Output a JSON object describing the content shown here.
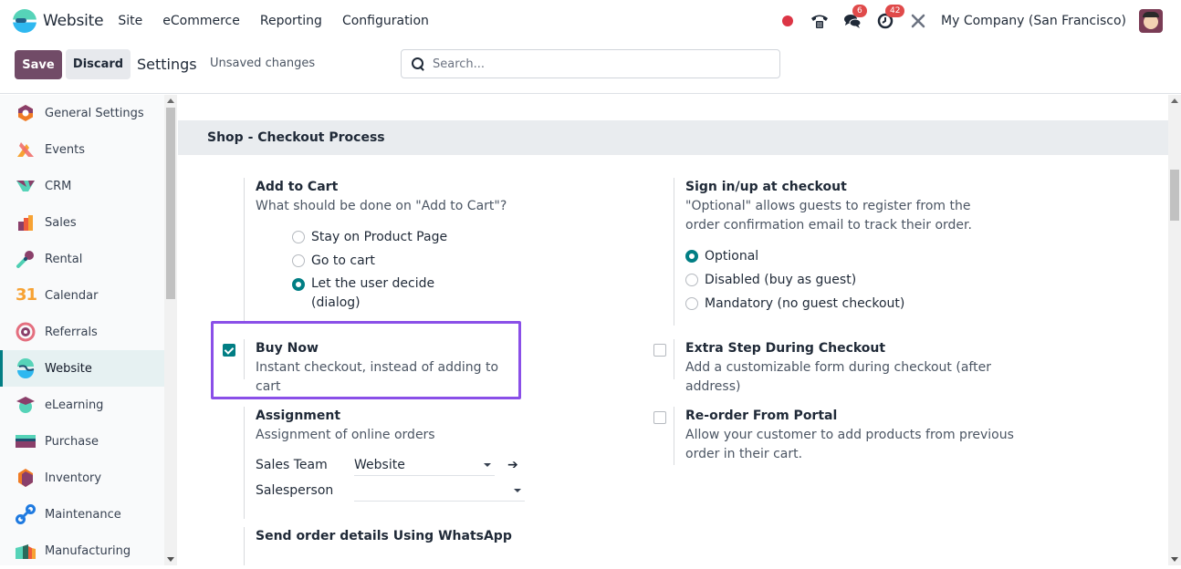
{
  "topbar": {
    "app_name": "Website",
    "menu": [
      "Site",
      "eCommerce",
      "Reporting",
      "Configuration"
    ],
    "messages_badge": "6",
    "activities_badge": "42",
    "company": "My Company (San Francisco)",
    "icons": [
      "recording-dot-icon",
      "phone-icon",
      "chat-icon",
      "clock-icon",
      "tools-icon",
      "user-avatar"
    ]
  },
  "controlbar": {
    "save_label": "Save",
    "discard_label": "Discard",
    "breadcrumb": "Settings",
    "status": "Unsaved changes",
    "search_placeholder": "Search...",
    "search_value": ""
  },
  "sidebar": {
    "items": [
      {
        "label": "General Settings",
        "icon": "general-settings-icon",
        "active": false
      },
      {
        "label": "Events",
        "icon": "events-icon",
        "active": false
      },
      {
        "label": "CRM",
        "icon": "crm-icon",
        "active": false
      },
      {
        "label": "Sales",
        "icon": "sales-icon",
        "active": false
      },
      {
        "label": "Rental",
        "icon": "rental-icon",
        "active": false
      },
      {
        "label": "Calendar",
        "icon": "calendar-icon",
        "active": false
      },
      {
        "label": "Referrals",
        "icon": "referrals-icon",
        "active": false
      },
      {
        "label": "Website",
        "icon": "website-icon",
        "active": true
      },
      {
        "label": "eLearning",
        "icon": "elearning-icon",
        "active": false
      },
      {
        "label": "Purchase",
        "icon": "purchase-icon",
        "active": false
      },
      {
        "label": "Inventory",
        "icon": "inventory-icon",
        "active": false
      },
      {
        "label": "Maintenance",
        "icon": "maintenance-icon",
        "active": false
      },
      {
        "label": "Manufacturing",
        "icon": "manufacturing-icon",
        "active": false
      }
    ],
    "calendar_glyph": "31"
  },
  "main": {
    "section_title": "Shop - Checkout Process",
    "add_to_cart": {
      "title": "Add to Cart",
      "desc": "What should be done on \"Add to Cart\"?",
      "options": [
        "Stay on Product Page",
        "Go to cart",
        "Let the user decide",
        "(dialog)"
      ],
      "selected": "Let the user decide (dialog)"
    },
    "sign_in": {
      "title": "Sign in/up at checkout",
      "desc": "\"Optional\" allows guests to register from the order confirmation email to track their order.",
      "options": [
        "Optional",
        "Disabled (buy as guest)",
        "Mandatory (no guest checkout)"
      ],
      "selected": "Optional"
    },
    "buy_now": {
      "title": "Buy Now",
      "desc": "Instant checkout, instead of adding to cart",
      "checked": true
    },
    "extra_step": {
      "title": "Extra Step During Checkout",
      "desc": "Add a customizable form during checkout (after address)",
      "checked": false
    },
    "reorder": {
      "title": "Re-order From Portal",
      "desc": "Allow your customer to add products from previous order in their cart.",
      "checked": false
    },
    "assignment": {
      "title": "Assignment",
      "desc": "Assignment of online orders",
      "sales_team_label": "Sales Team",
      "sales_team_value": "Website",
      "salesperson_label": "Salesperson",
      "salesperson_value": ""
    },
    "whatsapp": {
      "title": "Send order details Using WhatsApp"
    }
  },
  "colors": {
    "primary": "#714b67",
    "accent": "#017e84",
    "highlight": "#8a4fe8",
    "badge": "#e04a4a"
  }
}
